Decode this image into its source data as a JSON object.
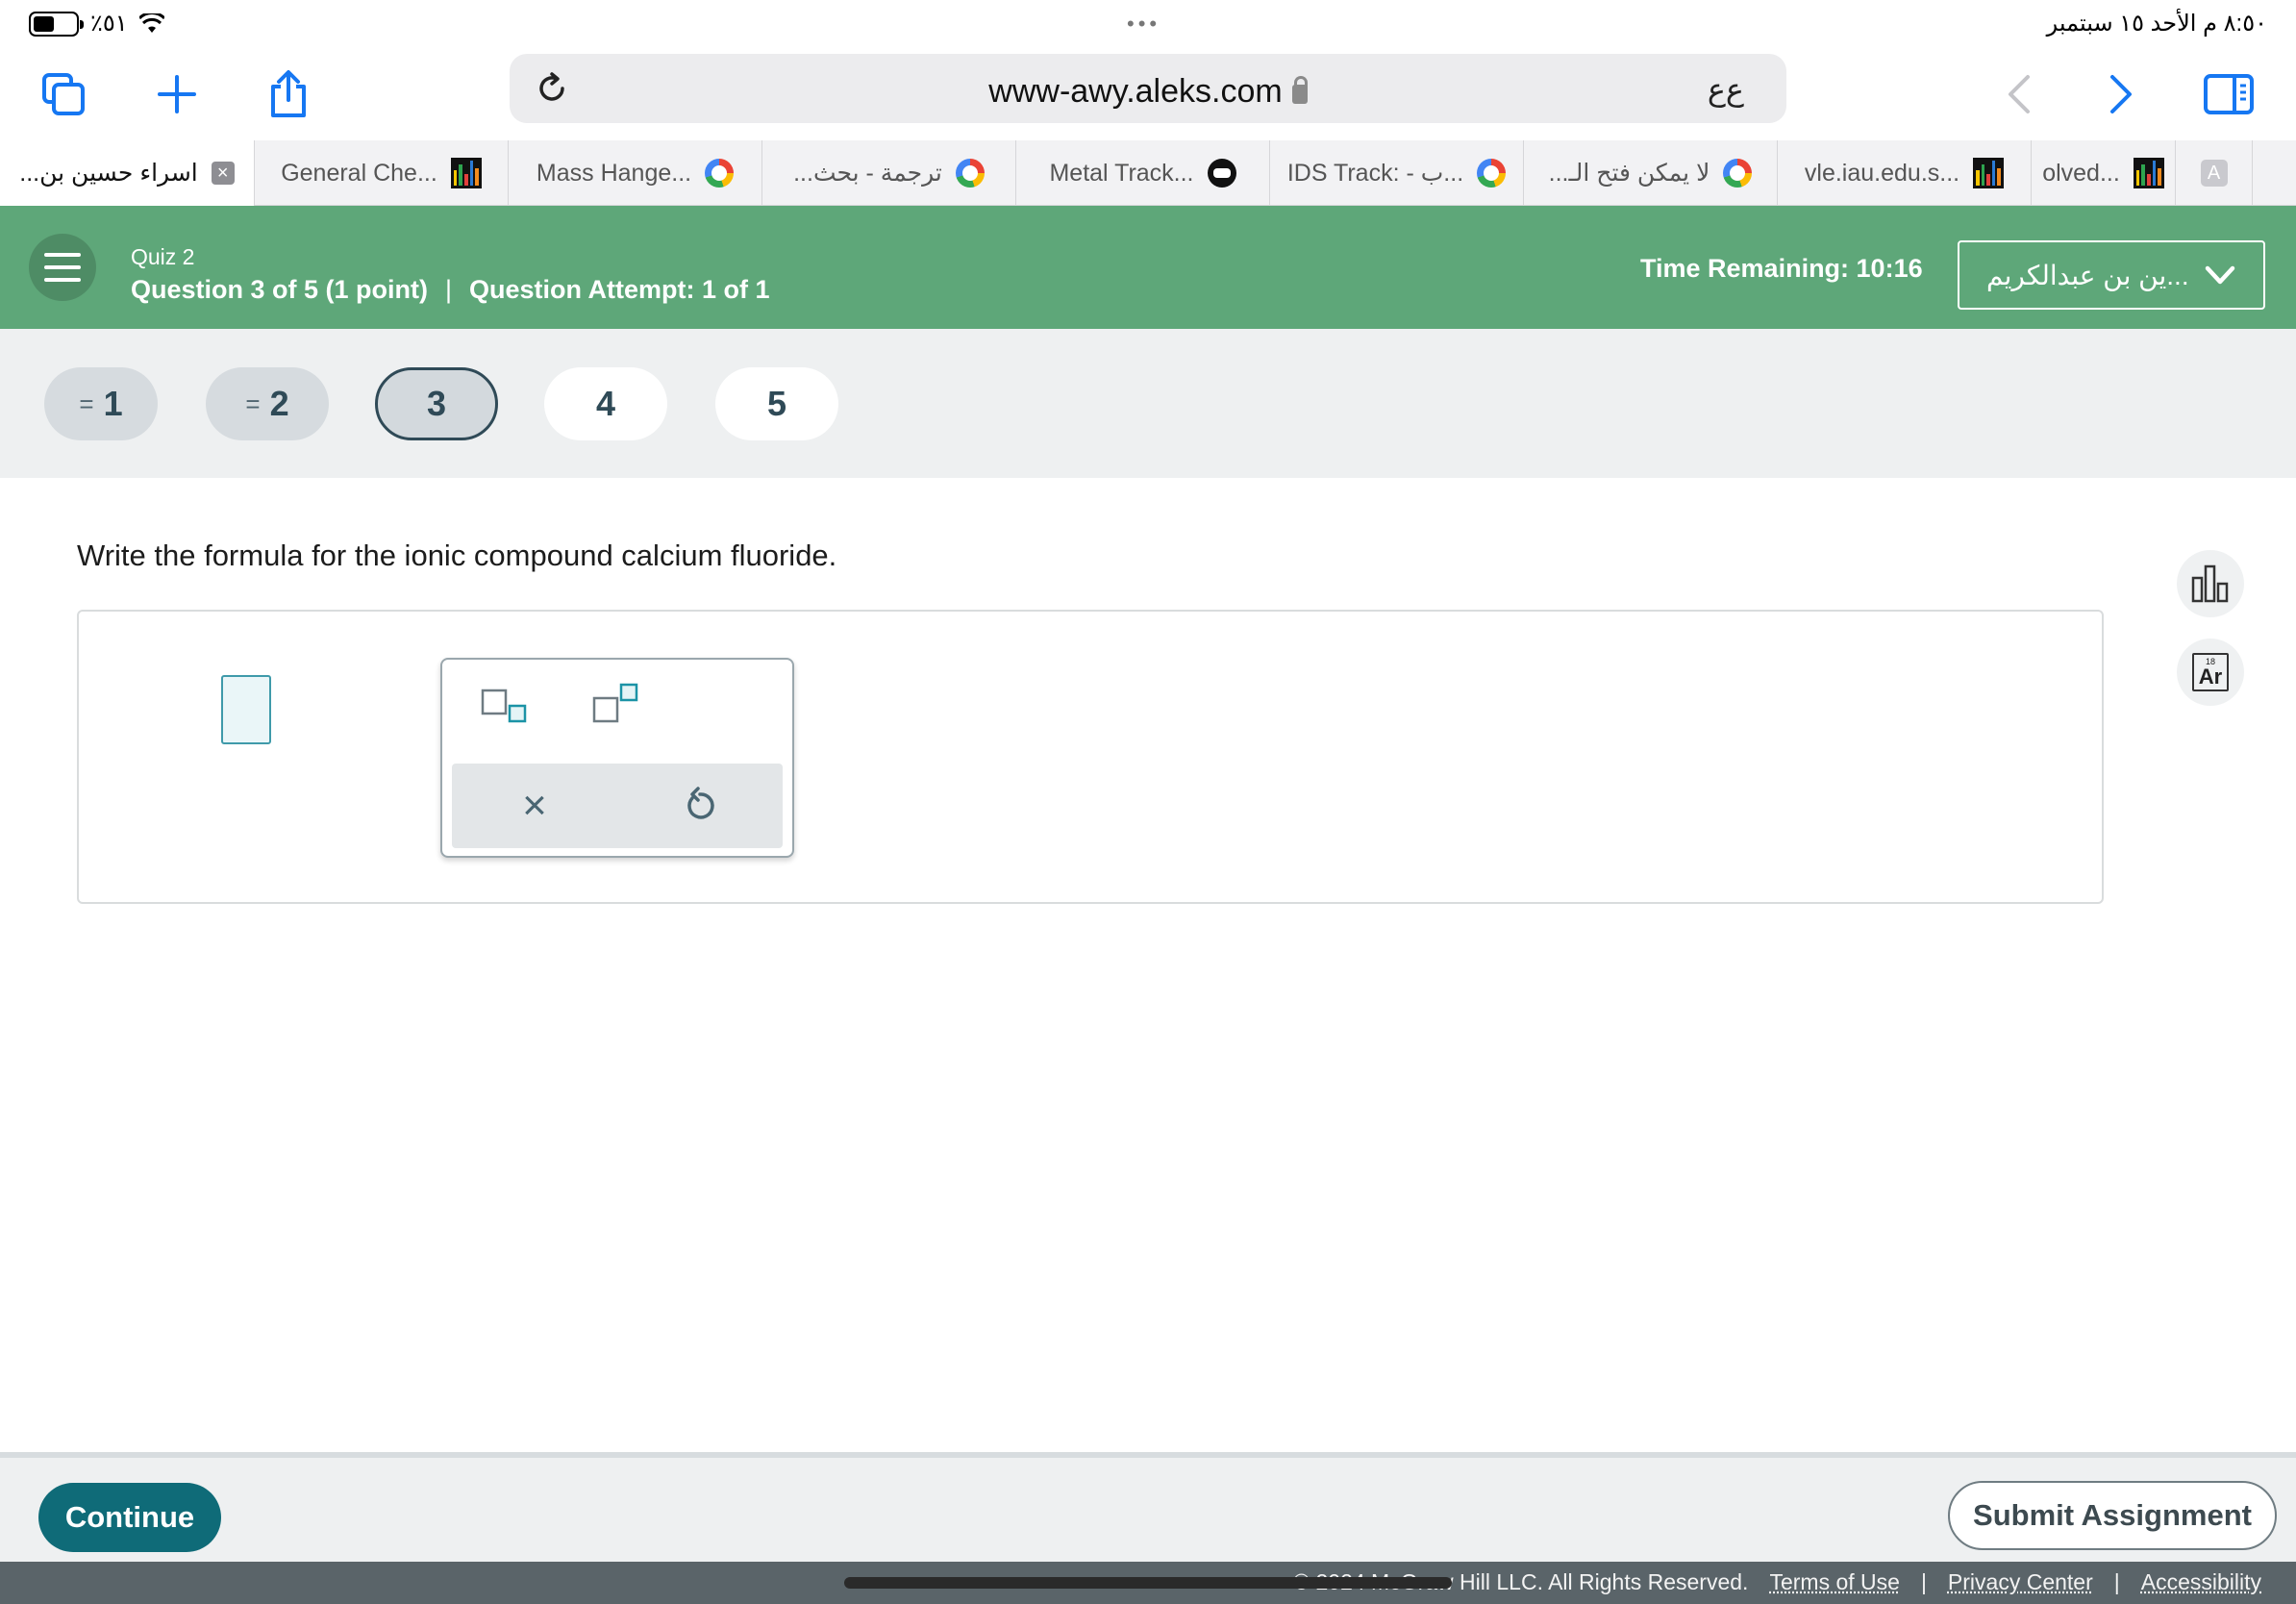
{
  "status_bar": {
    "battery": "٪٥١",
    "date_time": "٨:٥٠ م   الأحد ١٥ سبتمبر",
    "dots": "•••"
  },
  "browser": {
    "url": "www-awy.aleks.com",
    "reader_label": "ﻉﻉ",
    "tabs": [
      {
        "label": "اسراء حسين بن...",
        "icon": "close-x-icon",
        "active": true
      },
      {
        "label": "General Che...",
        "icon": "bars-logo-icon"
      },
      {
        "label": "Mass Hange...",
        "icon": "google-icon"
      },
      {
        "label": "ترجمة - بحث...",
        "icon": "google-icon"
      },
      {
        "label": "Metal Track...",
        "icon": "robot-icon"
      },
      {
        "label": "IDS Track: - ب...",
        "icon": "google-icon"
      },
      {
        "label": "لا يمكن فتح الـ...",
        "icon": "google-icon"
      },
      {
        "label": "vle.iau.edu.s...",
        "icon": "bars-logo-icon"
      },
      {
        "label": "olved...",
        "icon": "bars-logo-icon"
      },
      {
        "label": "A",
        "icon": "letter-a-icon"
      }
    ]
  },
  "header": {
    "quiz_title": "Quiz 2",
    "question_info": "Question 3 of 5 (1 point)",
    "separator": "|",
    "attempt_info": "Question Attempt: 1 of 1",
    "time_remaining": "Time Remaining: 10:16",
    "user_name": "...ين بن عبدالكريم"
  },
  "question_nav": [
    {
      "number": "1",
      "state": "answered",
      "mark": "="
    },
    {
      "number": "2",
      "state": "answered",
      "mark": "="
    },
    {
      "number": "3",
      "state": "current",
      "mark": ""
    },
    {
      "number": "4",
      "state": "open",
      "mark": ""
    },
    {
      "number": "5",
      "state": "open",
      "mark": ""
    }
  ],
  "question": {
    "prompt": "Write the formula for the ionic compound calcium fluoride."
  },
  "palette": {
    "subscript_icon": "subscript-template-icon",
    "superscript_icon": "superscript-template-icon",
    "clear_symbol": "×",
    "undo_icon": "undo-icon"
  },
  "side_tools": {
    "data_icon": "bar-chart-icon",
    "periodic_number": "18",
    "periodic_symbol": "Ar"
  },
  "footer": {
    "continue_label": "Continue",
    "submit_label": "Submit Assignment",
    "copyright": "© 2024 McGraw Hill LLC. All Rights Reserved.",
    "terms": "Terms of Use",
    "privacy": "Privacy Center",
    "accessibility": "Accessibility",
    "divider": "|"
  },
  "colors": {
    "header_green": "#5ea779",
    "continue_teal": "#0f6b78",
    "browser_blue": "#1677f2"
  }
}
